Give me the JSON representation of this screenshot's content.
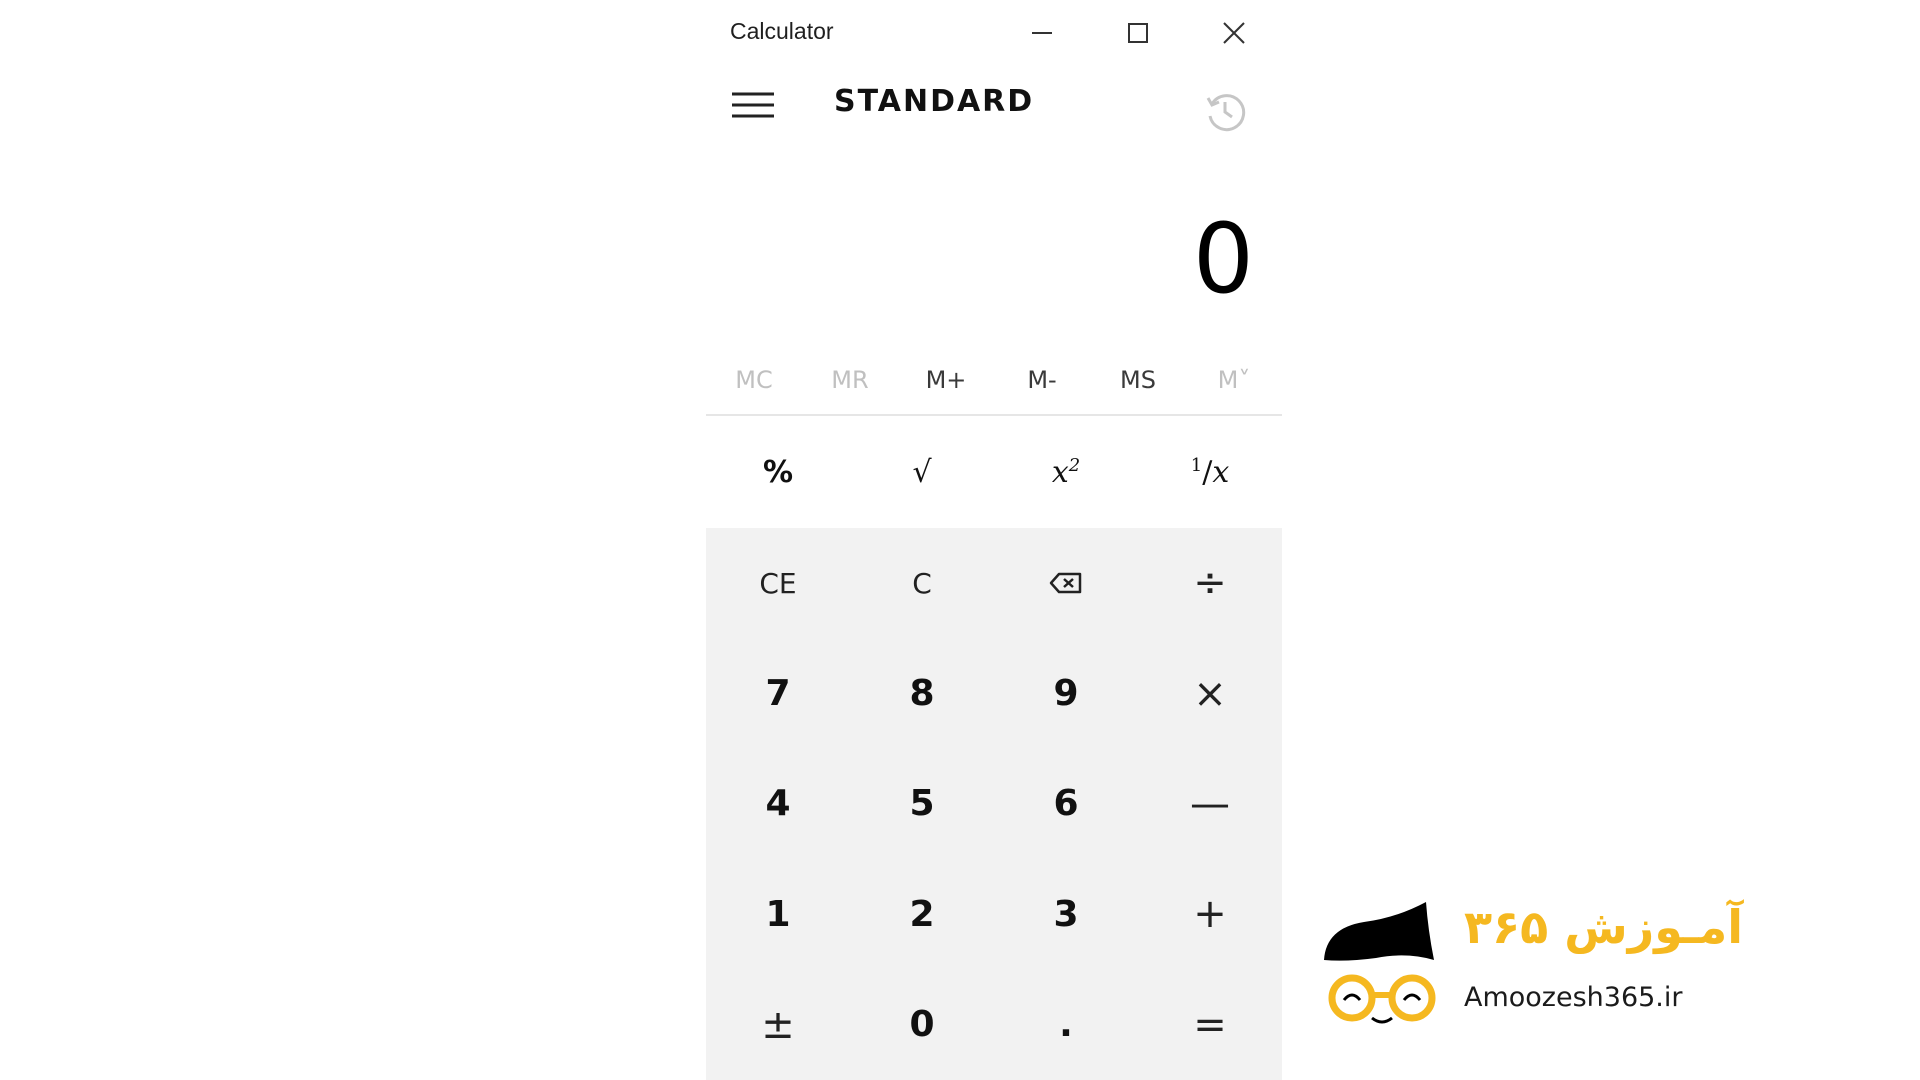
{
  "window": {
    "title": "Calculator",
    "controls": [
      "minimize",
      "maximize",
      "close"
    ]
  },
  "header": {
    "menu_icon": "hamburger-icon",
    "mode": "STANDARD",
    "history_icon": "history-icon"
  },
  "display": {
    "value": "0"
  },
  "memory": {
    "mc": "MC",
    "mr": "MR",
    "mplus": "M+",
    "mminus": "M-",
    "ms": "MS",
    "mlist": "M˅"
  },
  "scientific": {
    "percent": "%",
    "sqrt": "√",
    "square_base": "x",
    "square_exp": "2",
    "reciprocal_num": "1",
    "reciprocal_den": "x"
  },
  "keypad": {
    "ce": "CE",
    "c": "C",
    "backspace_icon": "backspace-icon",
    "divide": "÷",
    "d7": "7",
    "d8": "8",
    "d9": "9",
    "multiply": "×",
    "d4": "4",
    "d5": "5",
    "d6": "6",
    "minus": "—",
    "d1": "1",
    "d2": "2",
    "d3": "3",
    "plus": "+",
    "negate": "±",
    "d0": "0",
    "decimal": ".",
    "equals": "="
  },
  "watermark": {
    "brand": "آمـوزش ۳۶۵",
    "site": "Amoozesh365.ir",
    "accent_color": "#f5b820"
  }
}
